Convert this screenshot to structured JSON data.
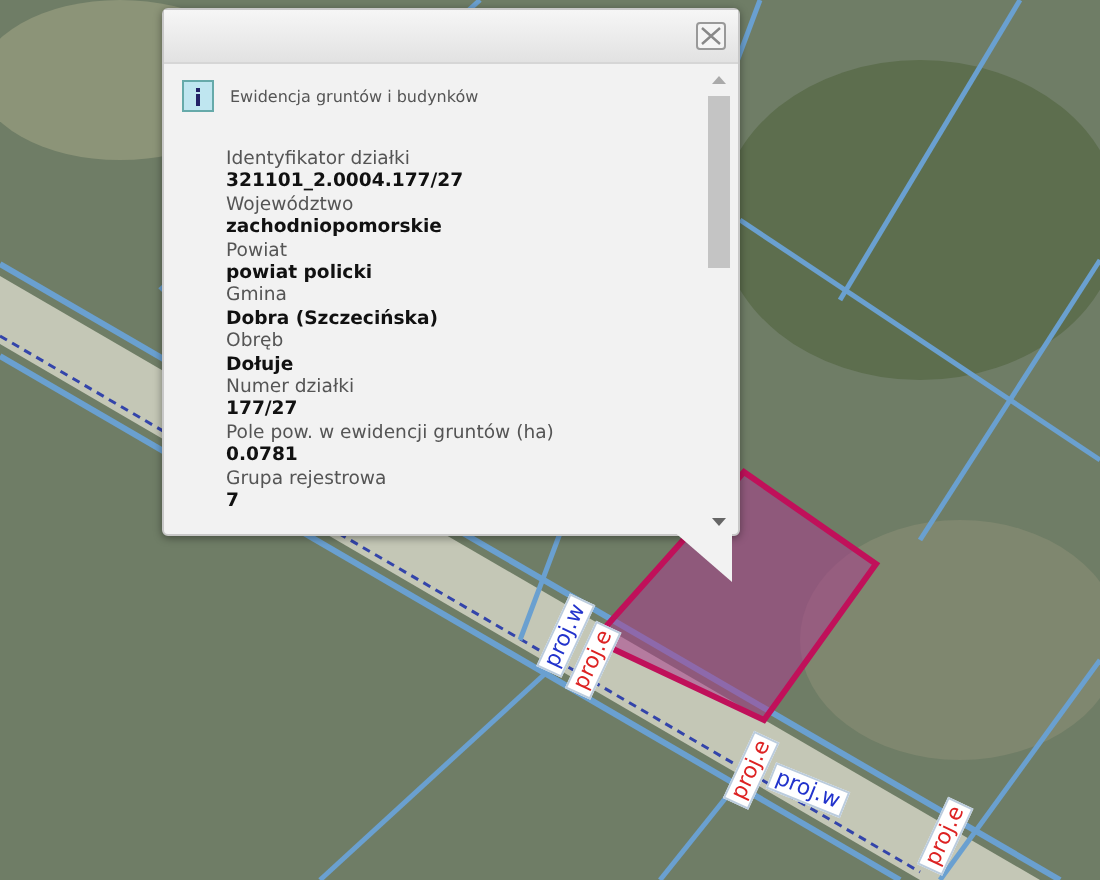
{
  "map": {
    "labels": [
      {
        "text": "proj.w",
        "kind": "w"
      },
      {
        "text": "proj.e",
        "kind": "e"
      },
      {
        "text": "proj.e",
        "kind": "e"
      },
      {
        "text": "proj.w",
        "kind": "w"
      },
      {
        "text": "proj.e",
        "kind": "e"
      }
    ]
  },
  "popup": {
    "title": "Ewidencja gruntów i budynków",
    "fields": [
      {
        "label": "Identyfikator działki",
        "value": "321101_2.0004.177/27"
      },
      {
        "label": "Województwo",
        "value": "zachodniopomorskie"
      },
      {
        "label": "Powiat",
        "value": "powiat policki"
      },
      {
        "label": "Gmina",
        "value": "Dobra (Szczecińska)"
      },
      {
        "label": "Obręb",
        "value": "Dołuje"
      },
      {
        "label": "Numer działki",
        "value": "177/27"
      },
      {
        "label": "Pole pow. w ewidencji gruntów (ha)",
        "value": "0.0781"
      },
      {
        "label": "Grupa rejestrowa",
        "value": "7"
      }
    ]
  }
}
